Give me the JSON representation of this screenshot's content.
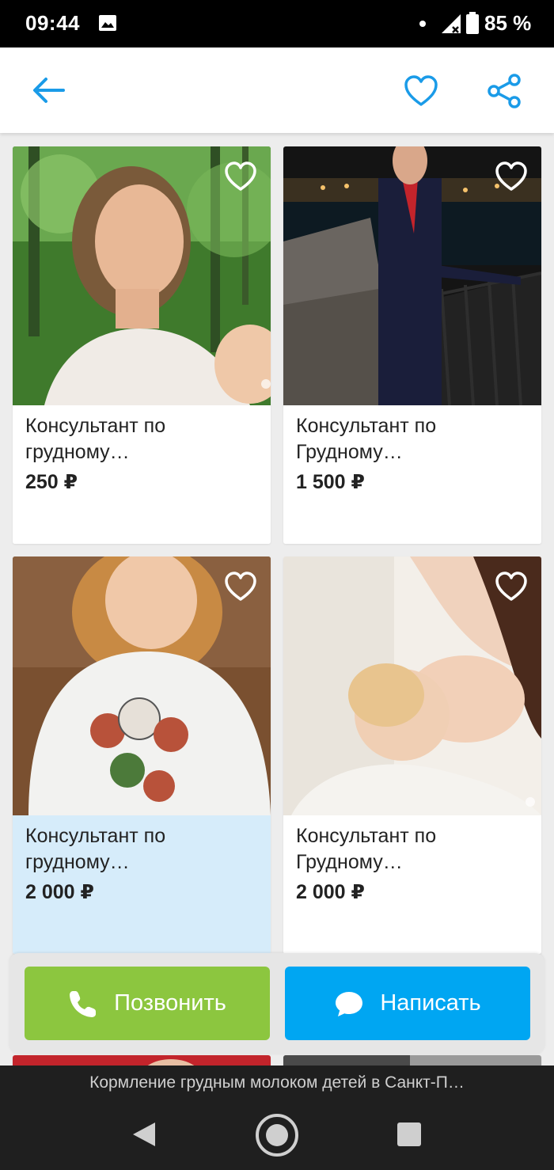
{
  "status_bar": {
    "time": "09:44",
    "battery": "85 %"
  },
  "toolbar": {
    "back_icon": "arrow-left-icon",
    "favorite_icon": "heart-outline-icon",
    "share_icon": "share-icon",
    "accent": "#1a9be8"
  },
  "listings": [
    {
      "title": "Консультант по грудному…",
      "price": "250 ₽"
    },
    {
      "title": "Консультант по Грудному…",
      "price": "1 500 ₽"
    },
    {
      "title": "Консультант по грудному…",
      "price": "2 000 ₽"
    },
    {
      "title": "Консультант по Грудному…",
      "price": "2 000 ₽"
    }
  ],
  "actions": {
    "call_label": "Позвонить",
    "call_color": "#8cc63f",
    "write_label": "Написать",
    "write_color": "#00a6f2"
  },
  "nav_bar": {
    "caption": "Кормление грудным молоком детей в Санкт-П…"
  }
}
